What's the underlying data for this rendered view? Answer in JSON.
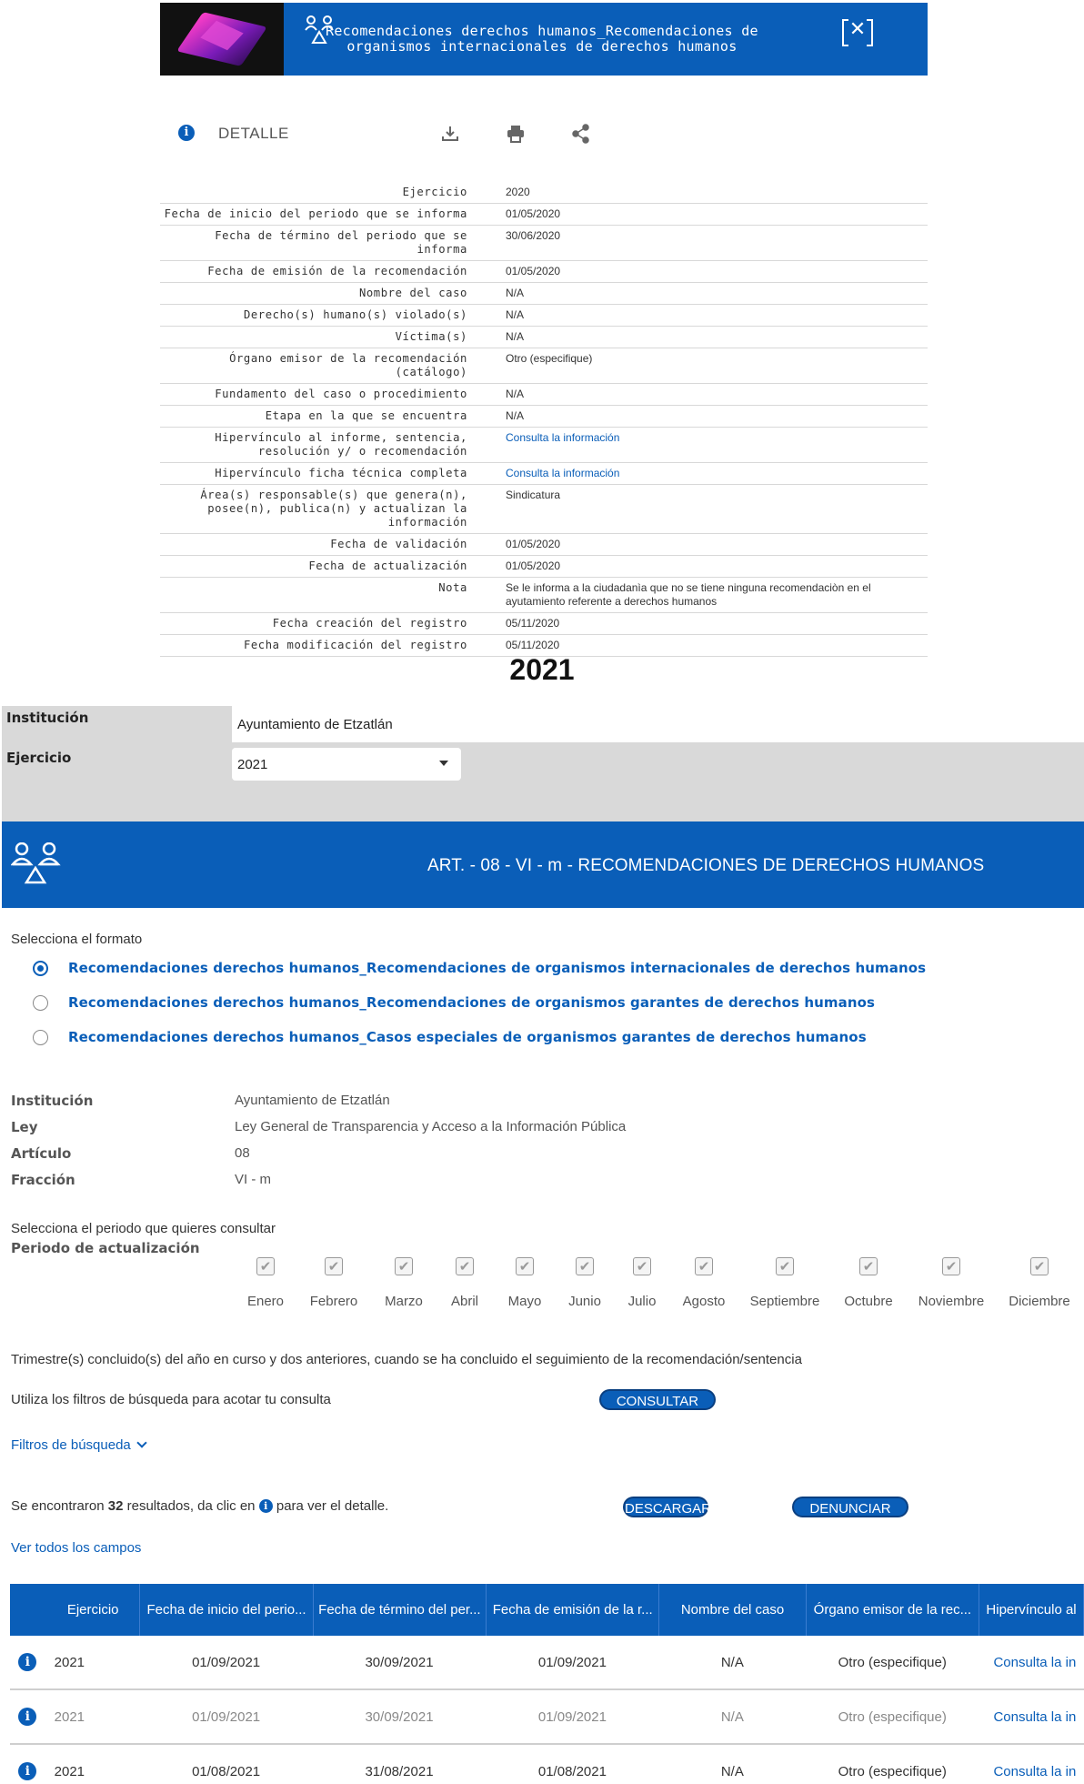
{
  "modal": {
    "title_line1": "Recomendaciones derechos humanos_Recomendaciones de",
    "title_line2": "organismos internacionales de derechos humanos"
  },
  "detalle": {
    "label": "DETALLE",
    "rows": [
      {
        "key": "Ejercicio",
        "value": "2020"
      },
      {
        "key": "Fecha de inicio del periodo que se informa",
        "value": "01/05/2020"
      },
      {
        "key": "Fecha de término del periodo que se informa",
        "value": "30/06/2020"
      },
      {
        "key": "Fecha de emisión de la recomendación",
        "value": "01/05/2020"
      },
      {
        "key": "Nombre del caso",
        "value": "N/A"
      },
      {
        "key": "Derecho(s) humano(s) violado(s)",
        "value": "N/A"
      },
      {
        "key": "Víctima(s)",
        "value": "N/A"
      },
      {
        "key": "Órgano emisor de la recomendación (catálogo)",
        "value": "Otro (especifique)"
      },
      {
        "key": "Fundamento del caso o procedimiento",
        "value": "N/A"
      },
      {
        "key": "Etapa en la que se encuentra",
        "value": "N/A"
      },
      {
        "key": "Hipervínculo al informe, sentencia, resolución y/ o recomendación",
        "value": "Consulta la información",
        "link": true
      },
      {
        "key": "Hipervínculo ficha técnica completa",
        "value": "Consulta la información",
        "link": true
      },
      {
        "key": "Área(s) responsable(s) que genera(n), posee(n), publica(n) y actualizan la información",
        "value": "Sindicatura"
      },
      {
        "key": "Fecha de validación",
        "value": "01/05/2020"
      },
      {
        "key": "Fecha de actualización",
        "value": "01/05/2020"
      },
      {
        "key": "Nota",
        "value": "Se le informa a la ciudadanìa que no se tiene ninguna recomendaciòn en el ayutamiento referente a derechos humanos"
      },
      {
        "key": "Fecha creación del registro",
        "value": "05/11/2020"
      },
      {
        "key": "Fecha modificación del registro",
        "value": "05/11/2020"
      }
    ]
  },
  "year_heading": "2021",
  "filters": {
    "institucion_label": "Institución",
    "institucion_value": "Ayuntamiento de Etzatlán",
    "ejercicio_label": "Ejercicio",
    "ejercicio_value": "2021"
  },
  "article": {
    "title": "ART. - 08 - VI - m - RECOMENDACIONES DE DERECHOS HUMANOS"
  },
  "format": {
    "prompt": "Selecciona el formato",
    "options": [
      {
        "label": "Recomendaciones derechos humanos_Recomendaciones de organismos internacionales de derechos humanos",
        "selected": true
      },
      {
        "label": "Recomendaciones derechos humanos_Recomendaciones de organismos garantes de derechos humanos",
        "selected": false
      },
      {
        "label": "Recomendaciones derechos humanos_Casos especiales de organismos garantes de derechos humanos",
        "selected": false
      }
    ]
  },
  "info": [
    {
      "key": "Institución",
      "value": "Ayuntamiento de Etzatlán"
    },
    {
      "key": "Ley",
      "value": "Ley General de Transparencia y Acceso a la Información Pública"
    },
    {
      "key": "Artículo",
      "value": "08"
    },
    {
      "key": "Fracción",
      "value": "VI - m"
    }
  ],
  "period": {
    "prompt": "Selecciona el periodo que quieres consultar",
    "label": "Periodo de actualización",
    "months": [
      "Enero",
      "Febrero",
      "Marzo",
      "Abril",
      "Mayo",
      "Junio",
      "Julio",
      "Agosto",
      "Septiembre",
      "Octubre",
      "Noviembre",
      "Diciembre"
    ],
    "check_glyph": "✔"
  },
  "trimestre_text": "Trimestre(s) concluido(s) del año en curso y dos anteriores, cuando se ha concluido el seguimiento de la recomendación/sentencia",
  "search": {
    "hint": "Utiliza los filtros de búsqueda para acotar tu consulta",
    "consultar": "CONSULTAR",
    "filtros": "Filtros de búsqueda"
  },
  "results": {
    "prefix": "Se encontraron",
    "count": "32",
    "suffix_before_icon": "resultados, da clic en",
    "suffix_after_icon": "para ver el detalle.",
    "descargar": "DESCARGAR",
    "denunciar": "DENUNCIAR",
    "ver_todos": "Ver todos los campos"
  },
  "table": {
    "headers": [
      "Ejercicio",
      "Fecha de inicio del perio...",
      "Fecha de término del per...",
      "Fecha de emisión de la r...",
      "Nombre del caso",
      "Órgano emisor de la rec...",
      "Hipervínculo al"
    ],
    "rows": [
      {
        "ejercicio": "2021",
        "inicio": "01/09/2021",
        "termino": "30/09/2021",
        "emision": "01/09/2021",
        "caso": "N/A",
        "organo": "Otro (especifique)",
        "link": "Consulta la in",
        "faded": false
      },
      {
        "ejercicio": "2021",
        "inicio": "01/09/2021",
        "termino": "30/09/2021",
        "emision": "01/09/2021",
        "caso": "N/A",
        "organo": "Otro (especifique)",
        "link": "Consulta la in",
        "faded": true
      },
      {
        "ejercicio": "2021",
        "inicio": "01/08/2021",
        "termino": "31/08/2021",
        "emision": "01/08/2021",
        "caso": "N/A",
        "organo": "Otro (especifique)",
        "link": "Consulta la in",
        "faded": false
      }
    ]
  },
  "colors": {
    "brand_blue": "#0a5eb8",
    "panel_gray": "#d9d9d9"
  }
}
